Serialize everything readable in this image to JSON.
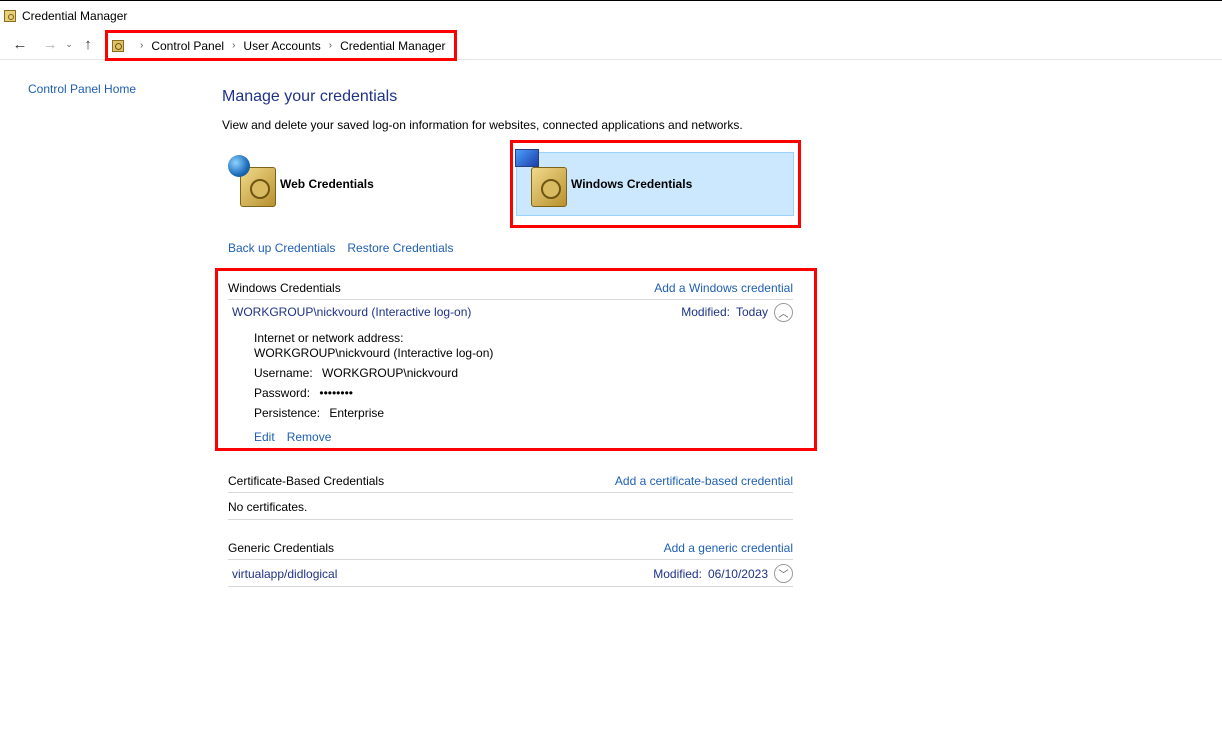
{
  "window": {
    "title": "Credential Manager"
  },
  "nav": {
    "back": "←",
    "forward": "→",
    "recent": "⌄",
    "up": "↑",
    "sep": "›"
  },
  "breadcrumb": [
    "Control Panel",
    "User Accounts",
    "Credential Manager"
  ],
  "sidebar": {
    "home_link": "Control Panel Home"
  },
  "main": {
    "heading": "Manage your credentials",
    "intro": "View and delete your saved log-on information for websites, connected applications and networks.",
    "tiles": {
      "web": "Web Credentials",
      "windows": "Windows Credentials"
    },
    "backup": "Back up Credentials",
    "restore": "Restore Credentials"
  },
  "windows_section": {
    "title": "Windows Credentials",
    "add": "Add a Windows credential",
    "entry": {
      "name": "WORKGROUP\\nickvourd (Interactive log-on)",
      "modified_label": "Modified:",
      "modified_value": "Today",
      "chevron": "︿",
      "address_label": "Internet or network address:",
      "address_value": "WORKGROUP\\nickvourd (Interactive log-on)",
      "username_label": "Username:",
      "username_value": "WORKGROUP\\nickvourd",
      "password_label": "Password:",
      "password_value": "••••••••",
      "persistence_label": "Persistence:",
      "persistence_value": "Enterprise",
      "edit": "Edit",
      "remove": "Remove"
    }
  },
  "certificate_section": {
    "title": "Certificate-Based Credentials",
    "add": "Add a certificate-based credential",
    "empty": "No certificates."
  },
  "generic_section": {
    "title": "Generic Credentials",
    "add": "Add a generic credential",
    "entry": {
      "name": "virtualapp/didlogical",
      "modified_label": "Modified:",
      "modified_value": "06/10/2023",
      "chevron": "﹀"
    }
  },
  "colors": {
    "link": "#1e5fb4",
    "heading": "#1e3287",
    "selected_tile": "#cce8ff",
    "highlight": "#ff0000"
  }
}
